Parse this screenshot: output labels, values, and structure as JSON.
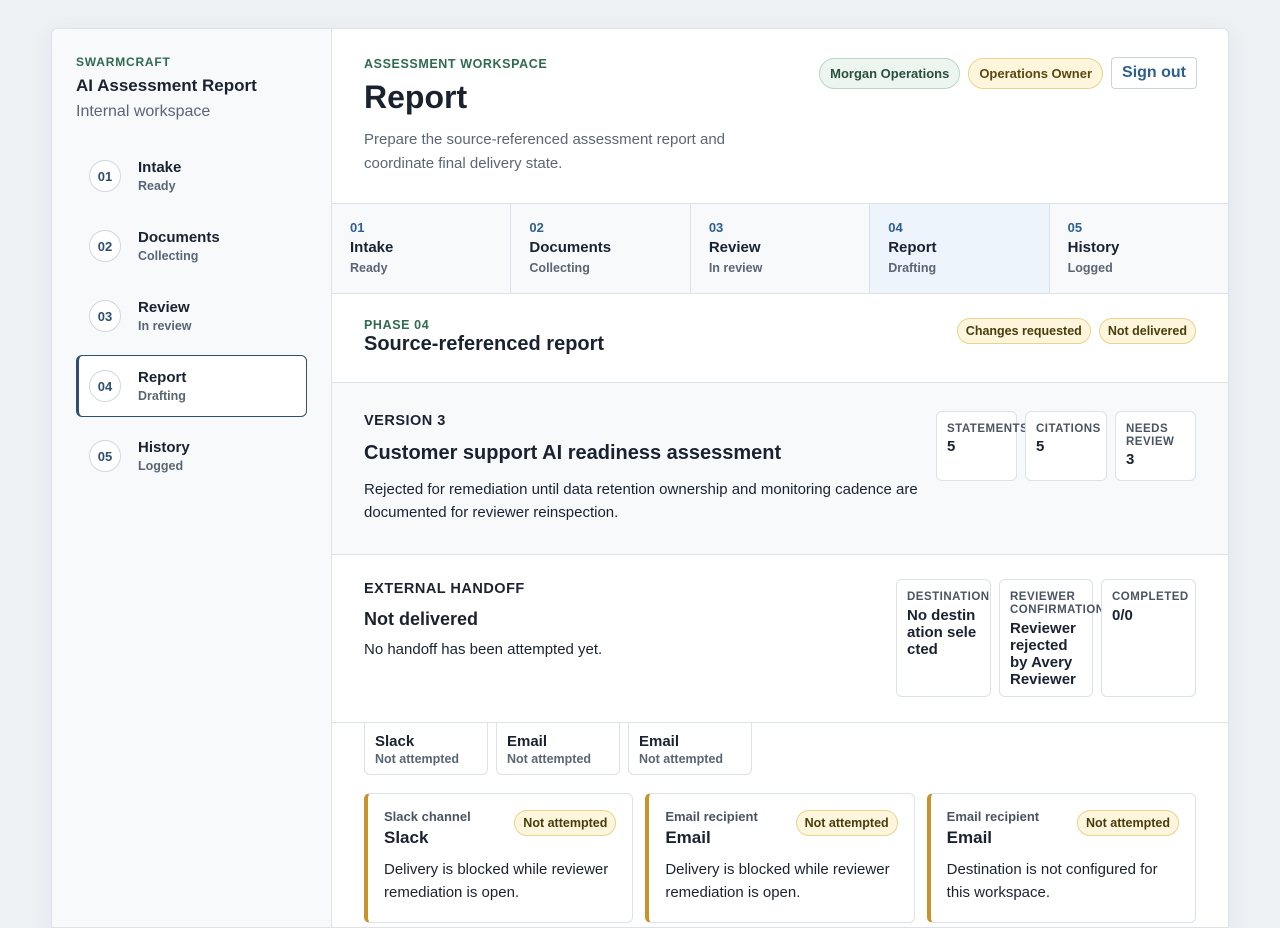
{
  "sidebar": {
    "brand": "SWARMCRAFT",
    "title": "AI Assessment Report",
    "subtitle": "Internal workspace",
    "steps": [
      {
        "num": "01",
        "name": "Intake",
        "status": "Ready"
      },
      {
        "num": "02",
        "name": "Documents",
        "status": "Collecting"
      },
      {
        "num": "03",
        "name": "Review",
        "status": "In review"
      },
      {
        "num": "04",
        "name": "Report",
        "status": "Drafting"
      },
      {
        "num": "05",
        "name": "History",
        "status": "Logged"
      }
    ]
  },
  "header": {
    "eyebrow": "ASSESSMENT WORKSPACE",
    "title": "Report",
    "description": "Prepare the source-referenced assessment report and coordinate final delivery state.",
    "user_pill": "Morgan Operations",
    "role_pill": "Operations Owner",
    "signout_label": "Sign out"
  },
  "tabs": [
    {
      "num": "01",
      "name": "Intake",
      "status": "Ready"
    },
    {
      "num": "02",
      "name": "Documents",
      "status": "Collecting"
    },
    {
      "num": "03",
      "name": "Review",
      "status": "In review"
    },
    {
      "num": "04",
      "name": "Report",
      "status": "Drafting"
    },
    {
      "num": "05",
      "name": "History",
      "status": "Logged"
    }
  ],
  "phase": {
    "label": "PHASE 04",
    "title": "Source-referenced report",
    "badges": [
      "Changes requested",
      "Not delivered"
    ]
  },
  "version": {
    "label": "VERSION 3",
    "title": "Customer support AI readiness assessment",
    "description": "Rejected for remediation until data retention ownership and monitoring cadence are documented for reviewer reinspection.",
    "stats": [
      {
        "label": "STATEMENTS",
        "value": "5"
      },
      {
        "label": "CITATIONS",
        "value": "5"
      },
      {
        "label": "NEEDS REVIEW",
        "value": "3"
      }
    ]
  },
  "handoff": {
    "label": "EXTERNAL HANDOFF",
    "title": "Not delivered",
    "description": "No handoff has been attempted yet.",
    "stats": [
      {
        "label": "DESTINATION",
        "value": "No destination selected"
      },
      {
        "label": "REVIEWER CONFIRMATION",
        "value": "Reviewer rejected by Avery Reviewer"
      },
      {
        "label": "COMPLETED",
        "value": "0/0"
      }
    ]
  },
  "channels": [
    {
      "name": "Slack",
      "status": "Not attempted"
    },
    {
      "name": "Email",
      "status": "Not attempted"
    },
    {
      "name": "Email",
      "status": "Not attempted"
    }
  ],
  "cards": [
    {
      "type": "Slack channel",
      "name": "Slack",
      "badge": "Not attempted",
      "description": "Delivery is blocked while reviewer remediation is open."
    },
    {
      "type": "Email recipient",
      "name": "Email",
      "badge": "Not attempted",
      "description": "Delivery is blocked while reviewer remediation is open."
    },
    {
      "type": "Email recipient",
      "name": "Email",
      "badge": "Not attempted",
      "description": "Destination is not configured for this workspace."
    }
  ],
  "colors": {
    "accent_green": "#2f6b4f",
    "accent_blue": "#2f5f8f",
    "warning_border": "#c9932b",
    "warning_bg": "#fdf6dd"
  }
}
